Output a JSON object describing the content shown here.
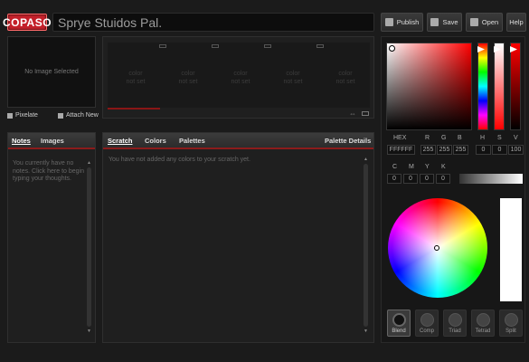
{
  "header": {
    "logo": "COPASO",
    "title": "Sprye Stuidos Pal.",
    "buttons": [
      {
        "label": "Publish",
        "icon": "publish-icon"
      },
      {
        "label": "Save",
        "icon": "save-icon"
      },
      {
        "label": "Open",
        "icon": "open-icon"
      },
      {
        "label": "Help"
      }
    ]
  },
  "image_area": {
    "placeholder": "No Image Selected",
    "pixelate_label": "Pixelate",
    "attach_label": "Attach New"
  },
  "swatches": {
    "slots": [
      {
        "line1": "color",
        "line2": "not set"
      },
      {
        "line1": "color",
        "line2": "not set"
      },
      {
        "line1": "color",
        "line2": "not set"
      },
      {
        "line1": "color",
        "line2": "not set"
      },
      {
        "line1": "color",
        "line2": "not set"
      }
    ]
  },
  "notes_panel": {
    "tabs": [
      "Notes",
      "Images"
    ],
    "message": "You currently have no notes. Click here to begin typing your thoughts."
  },
  "scratch_panel": {
    "tabs": [
      "Scratch",
      "Colors",
      "Palettes"
    ],
    "details_label": "Palette Details",
    "message": "You have not added any colors to your scratch yet."
  },
  "color_picker": {
    "labels": {
      "hex": "HEX",
      "r": "R",
      "g": "G",
      "b": "B",
      "h": "H",
      "s": "S",
      "v": "V",
      "c": "C",
      "m": "M",
      "y": "Y",
      "k": "K"
    },
    "values": {
      "hex": "FFFFFF",
      "r": "255",
      "g": "255",
      "b": "255",
      "h": "0",
      "s": "0",
      "v": "100",
      "c": "0",
      "m": "0",
      "y": "0",
      "k": "0"
    },
    "harmony_buttons": [
      "Blend",
      "Comp",
      "Triad",
      "Tetrad",
      "Split"
    ],
    "active_harmony": "Blend",
    "colors": {
      "accent": "#c4202a",
      "preview": "#ffffff"
    }
  }
}
